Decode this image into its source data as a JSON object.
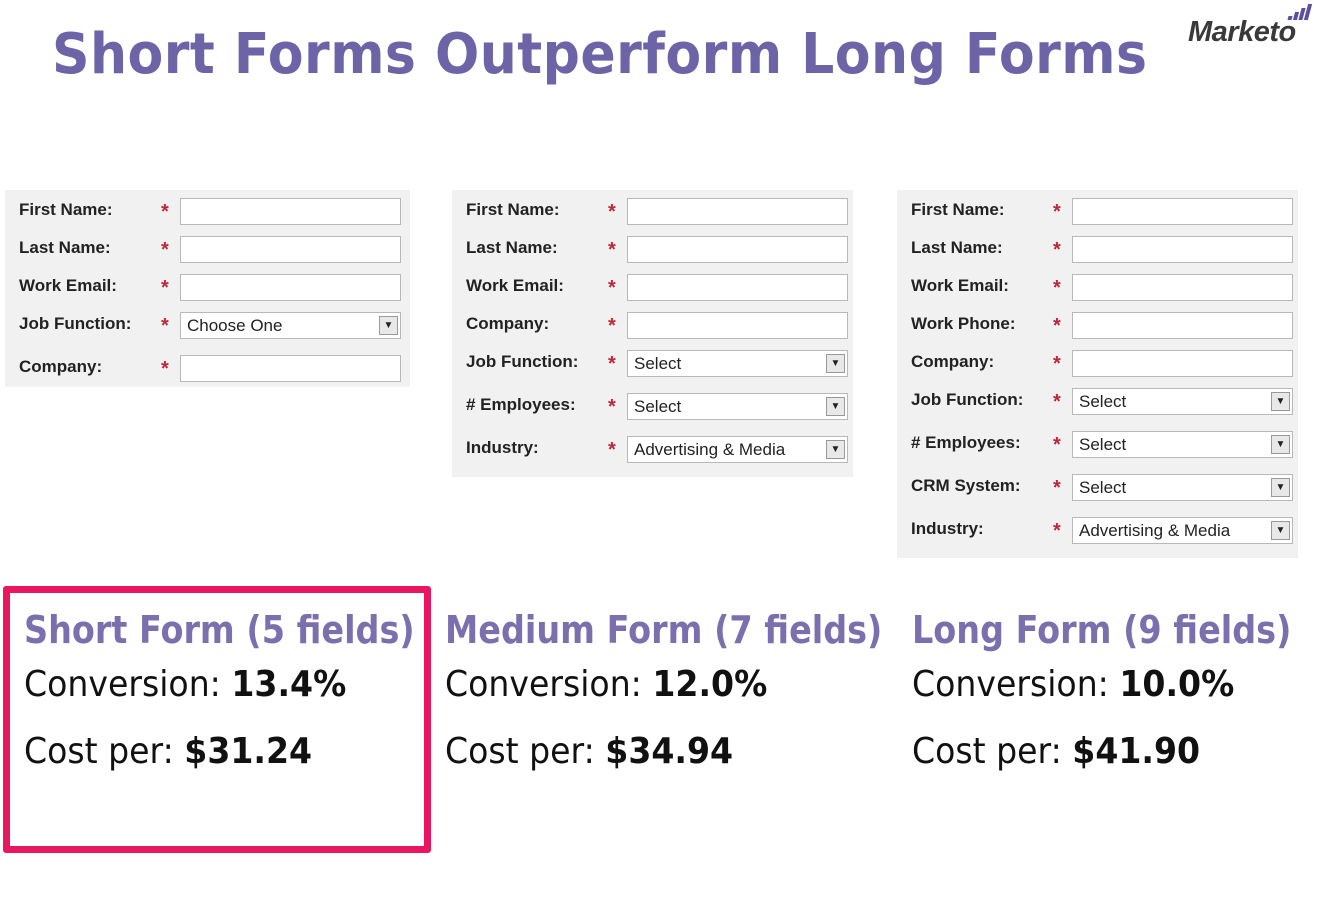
{
  "title": "Short Forms Outperform Long Forms",
  "logo": "Marketo",
  "colors": {
    "title": "#6d64a8",
    "highlight": "#e8175f",
    "required": "#c0263a"
  },
  "forms": [
    {
      "heading": "Short Form (5 fields)",
      "conversion_label": "Conversion:",
      "conversion": "13.4%",
      "cost_label": "Cost per:",
      "cost": "$31.24",
      "highlighted": true,
      "fields": [
        {
          "label": "First Name:",
          "type": "text",
          "value": ""
        },
        {
          "label": "Last Name:",
          "type": "text",
          "value": ""
        },
        {
          "label": "Work Email:",
          "type": "text",
          "value": ""
        },
        {
          "label": "Job Function:",
          "type": "select",
          "value": "Choose One"
        },
        {
          "label": "Company:",
          "type": "text",
          "value": ""
        }
      ]
    },
    {
      "heading": "Medium Form (7 fields)",
      "conversion_label": "Conversion:",
      "conversion": "12.0%",
      "cost_label": "Cost per:",
      "cost": "$34.94",
      "highlighted": false,
      "fields": [
        {
          "label": "First Name:",
          "type": "text",
          "value": ""
        },
        {
          "label": "Last Name:",
          "type": "text",
          "value": ""
        },
        {
          "label": "Work Email:",
          "type": "text",
          "value": ""
        },
        {
          "label": "Company:",
          "type": "text",
          "value": ""
        },
        {
          "label": "Job Function:",
          "type": "select",
          "value": "Select"
        },
        {
          "label": "# Employees:",
          "type": "select",
          "value": "Select"
        },
        {
          "label": "Industry:",
          "type": "select",
          "value": "Advertising & Media"
        }
      ]
    },
    {
      "heading": "Long Form (9 fields)",
      "conversion_label": "Conversion:",
      "conversion": "10.0%",
      "cost_label": "Cost per:",
      "cost": "$41.90",
      "highlighted": false,
      "fields": [
        {
          "label": "First Name:",
          "type": "text",
          "value": ""
        },
        {
          "label": "Last Name:",
          "type": "text",
          "value": ""
        },
        {
          "label": "Work Email:",
          "type": "text",
          "value": ""
        },
        {
          "label": "Work Phone:",
          "type": "text",
          "value": ""
        },
        {
          "label": "Company:",
          "type": "text",
          "value": ""
        },
        {
          "label": "Job Function:",
          "type": "select",
          "value": "Select"
        },
        {
          "label": "# Employees:",
          "type": "select",
          "value": "Select"
        },
        {
          "label": "CRM System:",
          "type": "select",
          "value": "Select"
        },
        {
          "label": "Industry:",
          "type": "select",
          "value": "Advertising & Media"
        }
      ]
    }
  ]
}
